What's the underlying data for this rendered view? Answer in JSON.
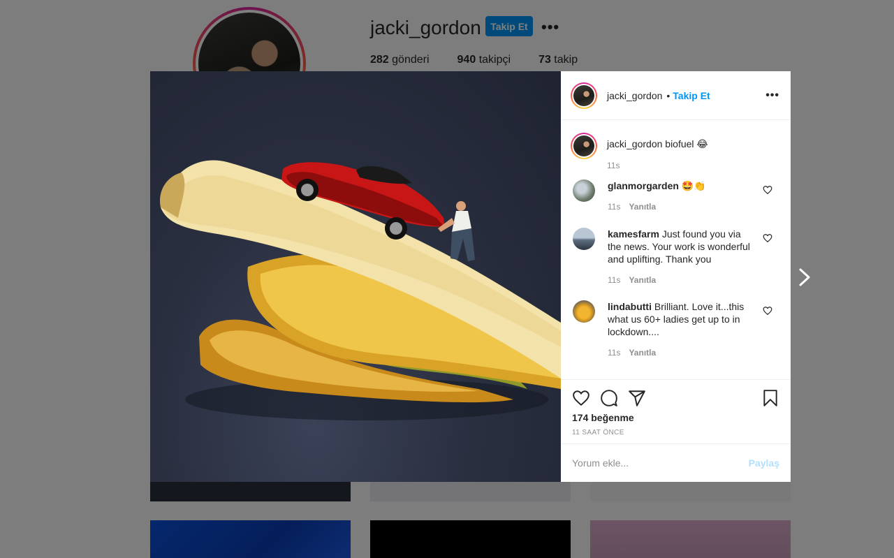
{
  "profile": {
    "username": "jacki_gordon",
    "follow_label": "Takip Et",
    "more_label": "•••",
    "stats": [
      {
        "count": "282",
        "label": "gönderi"
      },
      {
        "count": "940",
        "label": "takipçi"
      },
      {
        "count": "73",
        "label": "takip"
      }
    ]
  },
  "modal": {
    "header": {
      "username": "jacki_gordon",
      "separator": "•",
      "follow_label": "Takip Et",
      "more_label": "•••"
    },
    "caption": {
      "username": "jacki_gordon",
      "text": "biofuel 😂",
      "time": "11s"
    },
    "comments": [
      {
        "username": "glanmorgarden",
        "text": "🤩👏",
        "time": "11s",
        "reply": "Yanıtla",
        "avatar": "garden-avatar"
      },
      {
        "username": "kamesfarm",
        "text": "Just found you via the news. Your work is wonderful and uplifting. Thank you",
        "time": "11s",
        "reply": "Yanıtla",
        "avatar": "landscape-avatar"
      },
      {
        "username": "lindabutti",
        "text": "Brilliant. Love it...this what us 60+ ladies get up to in lockdown....",
        "time": "11s",
        "reply": "Yanıtla",
        "avatar": "duck-avatar"
      }
    ],
    "likes": "174 beğenme",
    "time_ago": "11 SAAT ÖNCE",
    "comment_placeholder": "Yorum ekle...",
    "post_label": "Paylaş"
  },
  "colors": {
    "accent": "#0095f6",
    "post_disabled": "#b2dffc",
    "meta_text": "#8e8e8e"
  }
}
